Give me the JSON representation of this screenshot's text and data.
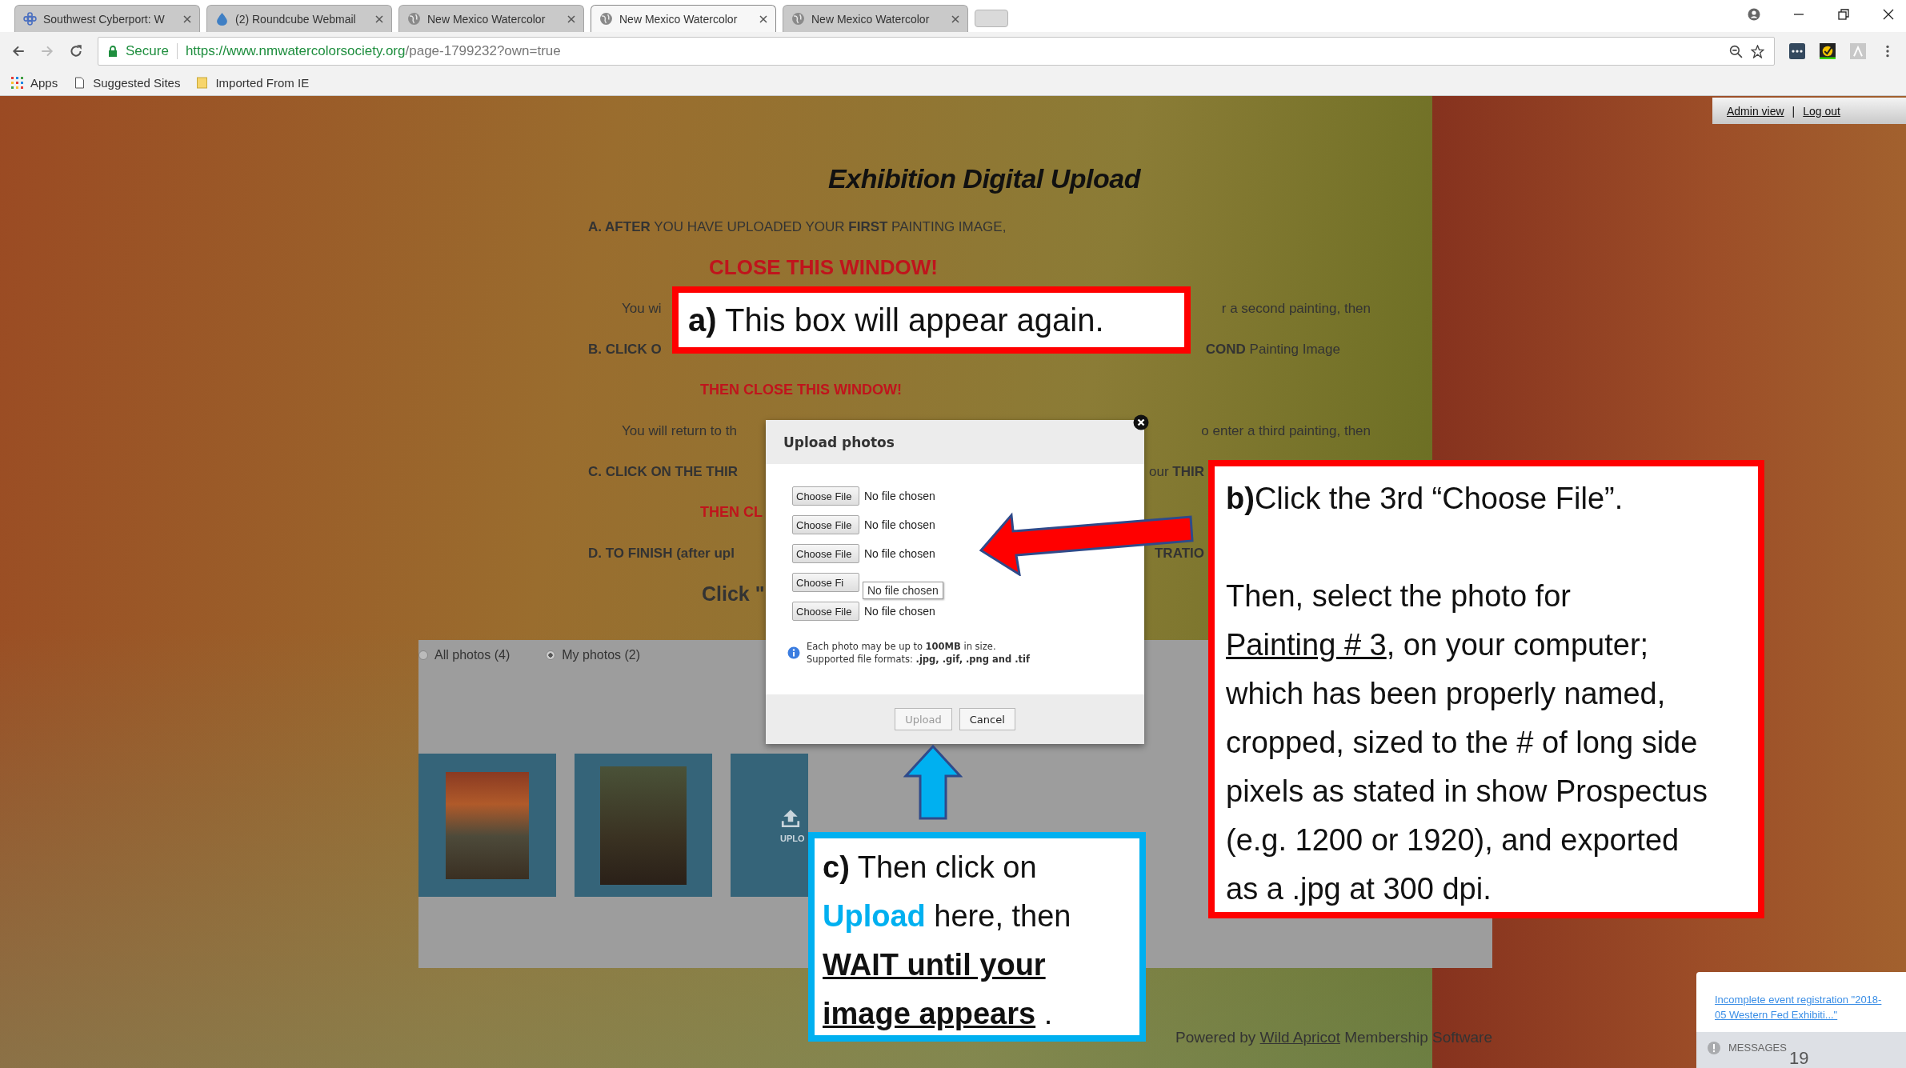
{
  "browser": {
    "tabs": [
      {
        "title": "Southwest Cyberport: W",
        "selected": false
      },
      {
        "title": "(2) Roundcube Webmail",
        "selected": false
      },
      {
        "title": "New Mexico Watercolor",
        "selected": false
      },
      {
        "title": "New Mexico Watercolor",
        "selected": true
      },
      {
        "title": "New Mexico Watercolor",
        "selected": false
      }
    ],
    "address": {
      "secure_label": "Secure",
      "url_host": "https://www.nmwatercolorsociety.org",
      "url_path": "/page-1799232?own=true"
    },
    "bookmarks": [
      "Apps",
      "Suggested Sites",
      "Imported From IE"
    ]
  },
  "admin_bar": {
    "links": [
      "Admin view",
      "Log out"
    ],
    "separator": "|"
  },
  "page": {
    "title": "Exhibition Digital Upload",
    "lines": [
      {
        "kind": "step",
        "left": "**A. AFTER** YOU HAVE UPLOADED YOUR **FIRST** PAINTING IMAGE,"
      },
      {
        "kind": "alert",
        "left": "CLOSE THIS WINDOW!"
      },
      {
        "kind": "note",
        "left": "You wi",
        "right": "r a second painting, then"
      },
      {
        "kind": "step",
        "left": "**B. CLICK O**",
        "right": "**COND** Painting Image"
      },
      {
        "kind": "alert-small",
        "left": "THEN CLOSE THIS WINDOW!"
      },
      {
        "kind": "note",
        "left": "You will return to th",
        "right": "o enter a third painting, then"
      },
      {
        "kind": "step-cut",
        "left": "**C. CLICK ON THE THIR**",
        "right": "our **THIR**"
      },
      {
        "kind": "alert-small",
        "left": "THEN CL"
      },
      {
        "kind": "step-cut",
        "left": "**D. TO FINISH (after upl**",
        "right": "**TRATIO**"
      },
      {
        "kind": "big",
        "left": "Click \""
      }
    ]
  },
  "gallery": {
    "filters": [
      {
        "label": "All photos (4)",
        "selected": false
      },
      {
        "label": "My photos (2)",
        "selected": true
      }
    ],
    "tiles": [
      {
        "kind": "photo"
      },
      {
        "kind": "photo"
      },
      {
        "kind": "upload",
        "label": "UPLO"
      }
    ]
  },
  "footer": {
    "prefix": "Powered by",
    "link": "Wild Apricot",
    "suffix": "Membership Software"
  },
  "dialog": {
    "title": "Upload photos",
    "files": [
      {
        "button": "Choose File",
        "status": "No file chosen"
      },
      {
        "button": "Choose File",
        "status": "No file chosen"
      },
      {
        "button": "Choose File",
        "status": "No file chosen"
      },
      {
        "button": "Choose Fi"
      },
      {
        "button": "Choose File",
        "status": "No file chosen"
      }
    ],
    "tooltip": "No file chosen",
    "info": [
      "Each photo may be up to **100MB** in size.",
      "Supported file formats: **.jpg, .gif, .png and .tif**"
    ],
    "buttons": [
      {
        "label": "Upload",
        "disabled": true
      },
      {
        "label": "Cancel",
        "disabled": false
      }
    ]
  },
  "callouts": [
    {
      "kind": "red",
      "paragraphs": [
        [
          {
            "kind": "bold",
            "text": "a)"
          },
          {
            "kind": "plain",
            "text": " This box will appear again."
          }
        ]
      ]
    },
    {
      "kind": "red",
      "paragraphs": [
        [
          {
            "kind": "bold",
            "text": "b)"
          },
          {
            "kind": "plain",
            "text": "Click the 3rd “Choose File”."
          }
        ],
        [
          {
            "kind": "plain",
            "text": "Then, select the photo for "
          },
          {
            "kind": "underline",
            "text": "Painting # 3"
          },
          {
            "kind": "plain",
            "text": ", on your computer; which has been properly named, cropped, sized to the # of long side pixels as stated in show Prospectus (e.g. 1200 or 1920), and exported as a .jpg at 300 dpi."
          }
        ]
      ]
    },
    {
      "kind": "blue",
      "paragraphs": [
        [
          {
            "kind": "bold",
            "text": "c)"
          },
          {
            "kind": "plain",
            "text": " Then click on "
          },
          {
            "kind": "highlight",
            "text": "Upload"
          },
          {
            "kind": "plain",
            "text": " here, then "
          },
          {
            "kind": "bold-underline",
            "text": "WAIT until your image appears"
          },
          {
            "kind": "plain",
            "text": " ."
          }
        ]
      ]
    }
  ],
  "messages": {
    "link": "Incomplete event registration \"2018-05 Western Fed Exhibiti...\"",
    "label": "MESSAGES",
    "count": "19"
  }
}
